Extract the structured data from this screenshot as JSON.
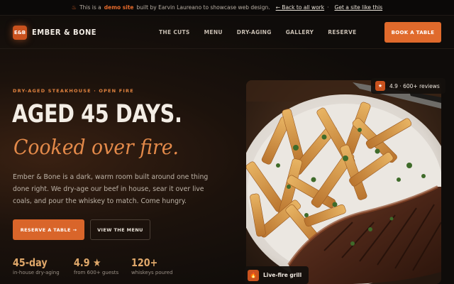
{
  "banner": {
    "prefix": "This is a",
    "demo": "demo site",
    "suffix": "built by Earvin Laureano to showcase web design.",
    "back_link": "← Back to all work",
    "cta_link": "Get a site like this",
    "icon": "flame-icon"
  },
  "nav": {
    "logo_badge": "E&B",
    "brand": "EMBER & BONE",
    "links": [
      "THE CUTS",
      "MENU",
      "DRY-AGING",
      "GALLERY",
      "RESERVE"
    ],
    "book": "BOOK A TABLE"
  },
  "hero": {
    "eyebrow": "DRY-AGED STEAKHOUSE · OPEN FIRE",
    "headline": "AGED 45 DAYS.",
    "script": "Cooked over fire.",
    "body": "Ember & Bone is a dark, warm room built around one thing done right. We dry-age our beef in house, sear it over live coals, and pour the whiskey to match. Come hungry.",
    "primary_btn": "RESERVE A TABLE →",
    "secondary_btn": "VIEW THE MENU"
  },
  "stats": [
    {
      "num": "45-day",
      "label": "in-house dry-aging"
    },
    {
      "num": "4.9",
      "star": "★",
      "label": "from 600+ guests"
    },
    {
      "num": "120+",
      "label": "whiskeys poured"
    }
  ],
  "photo": {
    "rating_badge": "★",
    "rating": "4.9 · 600+ reviews",
    "grill_badge": "🔥",
    "grill": "Live-fire grill"
  },
  "colors": {
    "accent": "#e06a2c",
    "gold": "#e0a86a",
    "background": "#0f0c0a"
  }
}
